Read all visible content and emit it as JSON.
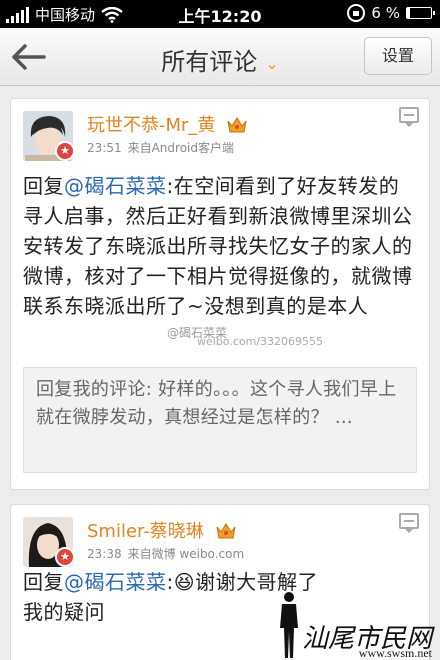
{
  "status_bar": {
    "carrier": "中国移动",
    "time": "上午12:20",
    "battery": "6 %",
    "icons": [
      "signal-bars-icon",
      "wifi-icon",
      "orientation-lock-icon",
      "battery-icon"
    ]
  },
  "nav": {
    "back_icon": "back-arrow-icon",
    "title": "所有评论",
    "dropdown_icon": "chevron-down-icon",
    "settings_label": "设置"
  },
  "comments": [
    {
      "username": "玩世不恭-Mr_黄",
      "badge_icon": "crown-icon",
      "time": "23:51",
      "source": "来自Android客户端",
      "reply_prefix": "回复",
      "mention": "@碣石菜菜",
      "text": ":在空间看到了好友转发的寻人启事，然后正好看到新浪微博里深圳公安转发了东晓派出所寻找失忆女子的家人的微博，核对了一下相片觉得挺像的，就微博联系东晓派出所了~没想到真的是本人",
      "quoted": "回复我的评论: 好样的。。。这个寻人我们早上就在微脖发动，真想经过是怎样的？ ..."
    },
    {
      "username": "Smiler-蔡晓琳",
      "badge_icon": "crown-icon",
      "time": "23:38",
      "source": "来自微博 weibo.com",
      "reply_prefix": "回复",
      "mention": "@碣石菜菜",
      "text": ":😆谢谢大哥解了我的疑问"
    }
  ],
  "watermarks": {
    "weibo_handle": "@碣石菜菜",
    "weibo_url": "weibo.com/332069555",
    "site_name": "汕尾市民网",
    "site_url": "www.swsm.net"
  },
  "colors": {
    "username": "#e5841f",
    "mention": "#2a68b5",
    "dropdown": "#f0a020",
    "badge": "#e0443e"
  }
}
